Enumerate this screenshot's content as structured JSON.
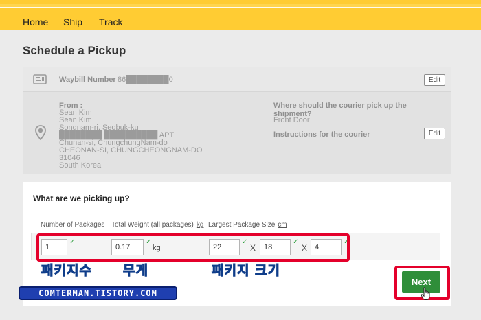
{
  "nav": {
    "items": [
      "Home",
      "Ship",
      "Track"
    ]
  },
  "page": {
    "title": "Schedule a Pickup"
  },
  "waybill": {
    "label": "Waybill Number",
    "number": "86████████0",
    "edit_label": "Edit"
  },
  "from": {
    "label": "From :",
    "lines": [
      "Sean Kim",
      "Sean Kim",
      "Songnam-ri, Seobuk-ku",
      "████████ ██████████ APT",
      "Chunan-si, ChungchungNam-do",
      "CHEONAN-SI, CHUNGCHEONGNAM-DO",
      "31046",
      "South Korea"
    ]
  },
  "pickup_location": {
    "question": "Where should the courier pick up the shipment?",
    "answer": "Front Door"
  },
  "instructions": {
    "label": "Instructions for the courier",
    "edit_label": "Edit"
  },
  "items": {
    "title": "What are we picking up?",
    "col_packages": "Number of Packages",
    "col_weight": "Total Weight (all packages)",
    "weight_unit_link": "kg",
    "col_size": "Largest Package Size",
    "size_unit_link": "cm",
    "packages_value": "1",
    "weight_value": "0.17",
    "weight_unit": "kg",
    "length_value": "22",
    "width_value": "18",
    "height_value": "4",
    "x_sep": "X"
  },
  "annotations": {
    "packages_count": "패키지수",
    "weight": "무게",
    "package_size": "패키지 크기"
  },
  "next_label": "Next",
  "watermark": "COMTERMAN.TISTORY.COM",
  "colors": {
    "nav_bg": "#ffcc33",
    "next_btn": "#2f8e3a",
    "highlight": "#e4002b",
    "annotation": "#1a8fe8"
  }
}
